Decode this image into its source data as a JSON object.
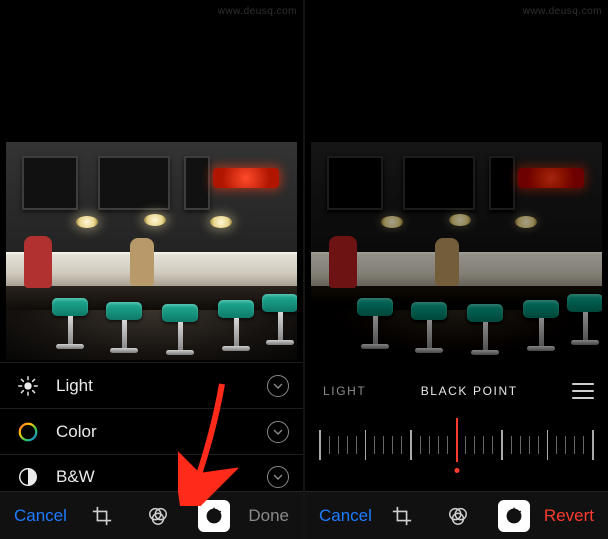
{
  "left": {
    "adjustments": [
      {
        "icon": "light-icon",
        "label": "Light"
      },
      {
        "icon": "color-icon",
        "label": "Color"
      },
      {
        "icon": "bw-icon",
        "label": "B&W"
      }
    ],
    "toolbar": {
      "cancel": "Cancel",
      "done": "Done",
      "active_tool": "adjust"
    }
  },
  "right": {
    "slider": {
      "left_label": "LIGHT",
      "center_label": "BLACK POINT"
    },
    "toolbar": {
      "cancel": "Cancel",
      "revert": "Revert",
      "active_tool": "adjust"
    }
  },
  "colors": {
    "accent_blue": "#1e7cff",
    "accent_red": "#ff3b30",
    "stool_teal": "#1fae96"
  },
  "annotation": {
    "type": "arrow",
    "target": "adjust-tool"
  },
  "watermark": "www.deusq.com"
}
